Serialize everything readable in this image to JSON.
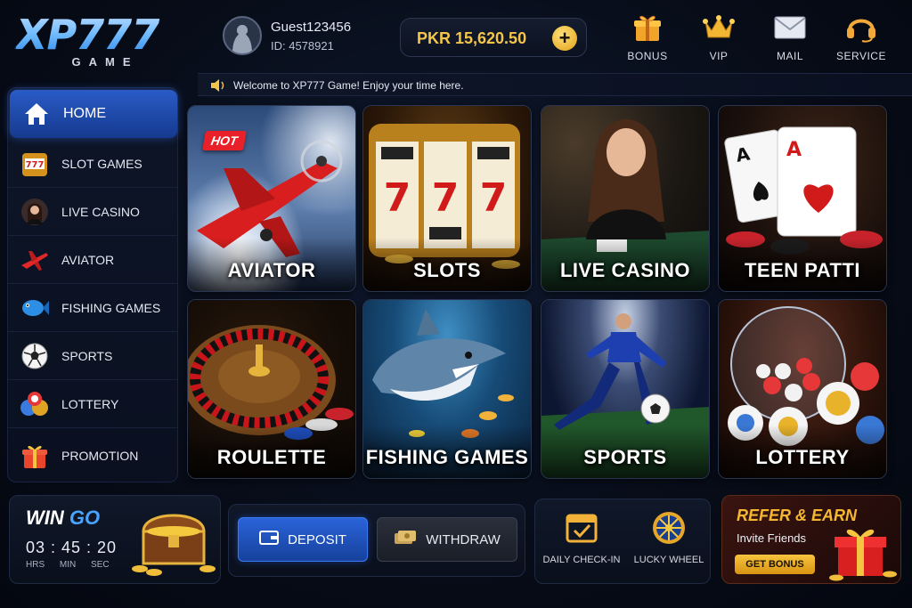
{
  "brand": {
    "logo_main": "XP777",
    "logo_sub": "GAME"
  },
  "user": {
    "name": "Guest123456",
    "id": "ID: 4578921"
  },
  "balance": {
    "text": "PKR 15,620.50",
    "plus": "+"
  },
  "top_nav": [
    {
      "label": "BONUS",
      "icon": "gift-icon"
    },
    {
      "label": "VIP",
      "icon": "crown-icon"
    },
    {
      "label": "MAIL",
      "icon": "mail-icon"
    },
    {
      "label": "SERVICE",
      "icon": "headset-icon"
    }
  ],
  "marquee": {
    "text": "Welcome to XP777 Game! Enjoy your time here."
  },
  "sidebar": {
    "items": [
      {
        "label": "HOME",
        "icon": "home-icon",
        "active": true
      },
      {
        "label": "SLOT GAMES",
        "icon": "slot-machine-icon"
      },
      {
        "label": "LIVE CASINO",
        "icon": "dealer-icon"
      },
      {
        "label": "AVIATOR",
        "icon": "plane-icon"
      },
      {
        "label": "FISHING GAMES",
        "icon": "fish-icon"
      },
      {
        "label": "SPORTS",
        "icon": "soccer-ball-icon"
      },
      {
        "label": "LOTTERY",
        "icon": "lottery-balls-icon"
      },
      {
        "label": "PROMOTION",
        "icon": "gift-icon"
      }
    ]
  },
  "games": [
    {
      "label": "AVIATOR",
      "badge": "HOT"
    },
    {
      "label": "SLOTS"
    },
    {
      "label": "LIVE CASINO"
    },
    {
      "label": "TEEN PATTI"
    },
    {
      "label": "ROULETTE"
    },
    {
      "label": "FISHING GAMES"
    },
    {
      "label": "SPORTS"
    },
    {
      "label": "LOTTERY"
    }
  ],
  "wingo": {
    "title_a": "WIN ",
    "title_b": "GO",
    "timer": "03 : 45 : 20",
    "units": [
      "HRS",
      "MIN",
      "SEC"
    ]
  },
  "wallet": {
    "deposit": "DEPOSIT",
    "withdraw": "WITHDRAW"
  },
  "quick": {
    "checkin": "DAILY CHECK-IN",
    "wheel": "LUCKY WHEEL"
  },
  "refer": {
    "title": "REFER & EARN",
    "subtitle": "Invite Friends",
    "button": "GET BONUS"
  },
  "colors": {
    "accent_blue": "#2a5bc6",
    "gold": "#f3c54a",
    "hot_red": "#e8202a"
  }
}
